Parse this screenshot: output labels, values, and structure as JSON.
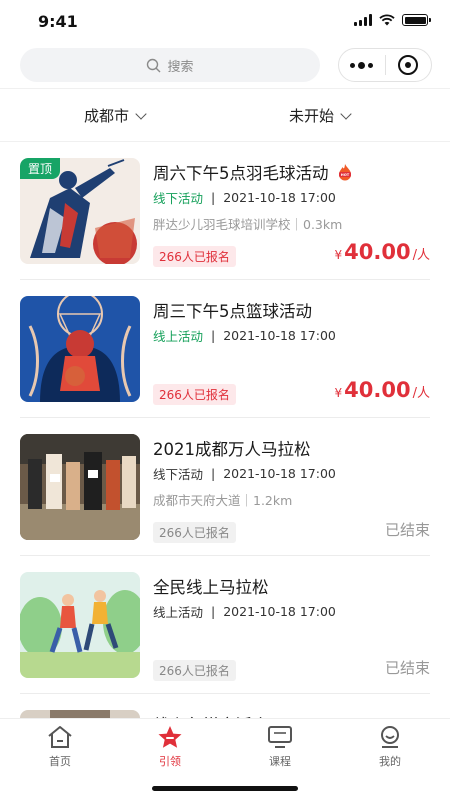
{
  "status": {
    "time": "9:41"
  },
  "search": {
    "placeholder": "搜索"
  },
  "filters": {
    "city": "成都市",
    "state": "未开始"
  },
  "events": [
    {
      "title": "周六下午5点羽毛球活动",
      "pinned": "置顶",
      "hot": true,
      "type": "线下活动",
      "type_color": "green",
      "datetime": "2021-10-18 17:00",
      "location": "胖达少儿羽毛球培训学校｜0.3km",
      "signups": "266人已报名",
      "price_currency": "¥",
      "price": "40.00",
      "price_unit": "/人",
      "ended": "",
      "image": "badminton"
    },
    {
      "title": "周三下午5点篮球活动",
      "pinned": "",
      "hot": false,
      "type": "线上活动",
      "type_color": "green",
      "datetime": "2021-10-18 17:00",
      "location": "",
      "signups": "266人已报名",
      "price_currency": "¥",
      "price": "40.00",
      "price_unit": "/人",
      "ended": "",
      "image": "basketball"
    },
    {
      "title": "2021成都万人马拉松",
      "pinned": "",
      "hot": false,
      "type": "线下活动",
      "type_color": "gray",
      "datetime": "2021-10-18 17:00",
      "location": "成都市天府大道｜1.2km",
      "signups": "266人已报名",
      "price_currency": "",
      "price": "",
      "price_unit": "",
      "ended": "已结束",
      "image": "marathon"
    },
    {
      "title": "全民线上马拉松",
      "pinned": "",
      "hot": false,
      "type": "线上活动",
      "type_color": "gray",
      "datetime": "2021-10-18 17:00",
      "location": "",
      "signups": "266人已报名",
      "price_currency": "",
      "price": "",
      "price_unit": "",
      "ended": "已结束",
      "image": "runners"
    },
    {
      "title": "线上象棋赛活会",
      "pinned": "",
      "hot": false,
      "type": "",
      "type_color": "gray",
      "datetime": "",
      "location": "",
      "signups": "",
      "price_currency": "",
      "price": "",
      "price_unit": "",
      "ended": "",
      "image": "partial"
    }
  ],
  "tabbar": [
    {
      "label": "首页",
      "icon": "home-icon",
      "active": false
    },
    {
      "label": "引领",
      "icon": "star-icon",
      "active": true
    },
    {
      "label": "课程",
      "icon": "course-icon",
      "active": false
    },
    {
      "label": "我的",
      "icon": "profile-icon",
      "active": false
    }
  ],
  "colors": {
    "accent": "#e0303a",
    "green": "#15a05a",
    "tag_green": "#17a466"
  }
}
